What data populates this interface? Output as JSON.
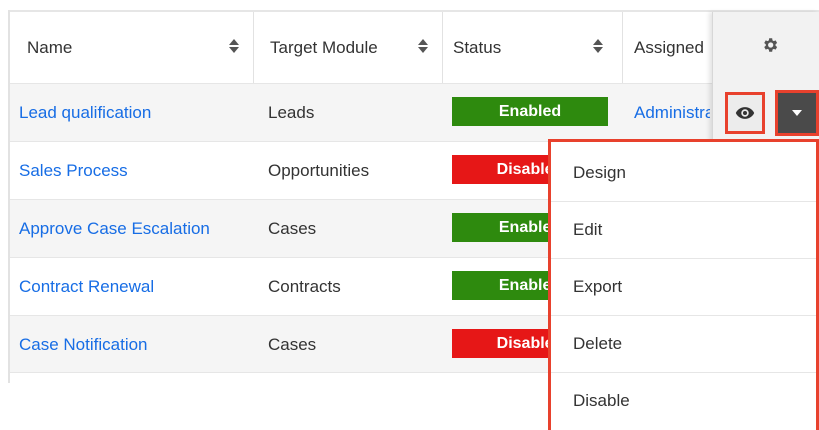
{
  "columns": {
    "name": "Name",
    "target_module": "Target Module",
    "status": "Status",
    "assigned": "Assigned"
  },
  "rows": [
    {
      "name": "Lead qualification",
      "module": "Leads",
      "status": "Enabled",
      "assigned": "Administrator"
    },
    {
      "name": "Sales Process",
      "module": "Opportunities",
      "status": "Disabled",
      "assigned": ""
    },
    {
      "name": "Approve Case Escalation",
      "module": "Cases",
      "status": "Enabled",
      "assigned": ""
    },
    {
      "name": "Contract Renewal",
      "module": "Contracts",
      "status": "Enabled",
      "assigned": ""
    },
    {
      "name": "Case Notification",
      "module": "Cases",
      "status": "Disabled",
      "assigned": ""
    }
  ],
  "actions_menu": [
    "Design",
    "Edit",
    "Export",
    "Delete",
    "Disable"
  ],
  "icons": {
    "settings": "gear-icon",
    "preview": "eye-icon",
    "dropdown": "caret-down-icon",
    "sort": "sort-icon"
  },
  "colors": {
    "link": "#176de5",
    "enabled": "#2e8a0e",
    "disabled": "#e61717",
    "highlight": "#e8412d"
  }
}
